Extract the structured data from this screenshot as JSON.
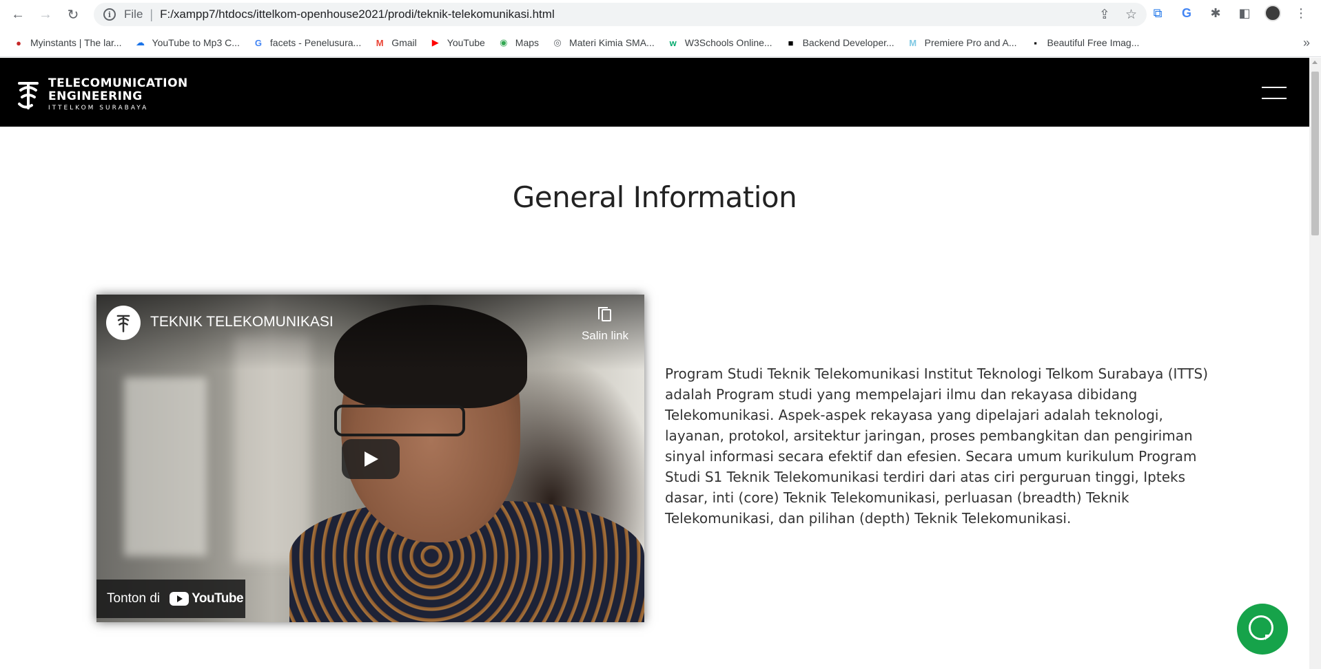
{
  "browser": {
    "url_scheme": "File",
    "url": "F:/xampp7/htdocs/ittelkom-openhouse2021/prodi/teknik-telekomunikasi.html",
    "bookmarks": [
      {
        "label": "Myinstants | The lar...",
        "icon": "myinstants-icon",
        "color": "#c62828"
      },
      {
        "label": "YouTube to Mp3 C...",
        "icon": "cloud-download-icon",
        "color": "#1a73e8"
      },
      {
        "label": "facets - Penelusura...",
        "icon": "google-icon",
        "color": "#4285f4"
      },
      {
        "label": "Gmail",
        "icon": "gmail-icon",
        "color": "#ea4335"
      },
      {
        "label": "YouTube",
        "icon": "youtube-icon",
        "color": "#ff0000"
      },
      {
        "label": "Maps",
        "icon": "maps-icon",
        "color": "#34a853"
      },
      {
        "label": "Materi Kimia SMA...",
        "icon": "globe-icon",
        "color": "#5f6368"
      },
      {
        "label": "W3Schools Online...",
        "icon": "w3schools-icon",
        "color": "#04aa6d"
      },
      {
        "label": "Backend Developer...",
        "icon": "roadmap-icon",
        "color": "#000000"
      },
      {
        "label": "Premiere Pro and A...",
        "icon": "motion-array-icon",
        "color": "#7ec8e3"
      },
      {
        "label": "Beautiful Free Imag...",
        "icon": "unsplash-icon",
        "color": "#111111"
      }
    ],
    "bookmarks_more": "»"
  },
  "site": {
    "logo_line1": "TELECOMUNICATION",
    "logo_line2": "ENGINEERING",
    "logo_sub": "ITTELKOM SURABAYA",
    "section_title": "General Information",
    "description": "Program Studi Teknik Telekomunikasi Institut Teknologi Telkom Surabaya (ITTS) adalah Program studi yang mempelajari ilmu dan rekayasa dibidang Telekomunikasi. Aspek-aspek rekayasa yang dipelajari adalah teknologi, layanan, protokol, arsitektur jaringan, proses pembangkitan dan pengiriman sinyal informasi secara efektif dan efesien. Secara umum kurikulum Program Studi S1 Teknik Telekomunikasi terdiri dari atas ciri perguruan tinggi, Ipteks dasar, inti (core) Teknik Telekomunikasi, perluasan (breadth) Teknik Telekomunikasi, dan pilihan (depth) Teknik Telekomunikasi."
  },
  "video": {
    "title": "TEKNIK TELEKOMUNIKASI",
    "copy_link_label": "Salin link",
    "watch_on_label": "Tonton di",
    "youtube_word": "YouTube"
  },
  "colors": {
    "header_bg": "#000000",
    "chat_green": "#16a34a"
  }
}
